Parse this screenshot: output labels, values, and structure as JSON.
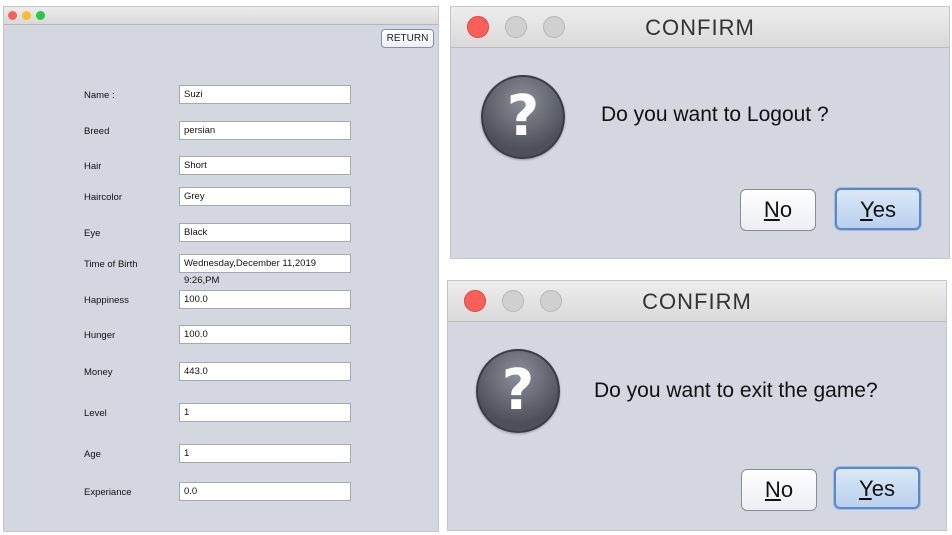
{
  "pet_window": {
    "return_label": "RETURN",
    "fields": [
      {
        "label": "Name :",
        "value": "Suzi"
      },
      {
        "label": "Breed",
        "value": "persian"
      },
      {
        "label": "Hair",
        "value": "Short"
      },
      {
        "label": "Haircolor",
        "value": "Grey"
      },
      {
        "label": "Eye",
        "value": "Black"
      },
      {
        "label": "Time of Birth",
        "value": "Wednesday,December 11,2019 9:26,PM"
      },
      {
        "label": "Happiness",
        "value": "100.0"
      },
      {
        "label": "Hunger",
        "value": "100.0"
      },
      {
        "label": "Money",
        "value": "443.0"
      },
      {
        "label": "Level",
        "value": "1"
      },
      {
        "label": "Age",
        "value": "1"
      },
      {
        "label": "Experiance",
        "value": "0.0"
      }
    ]
  },
  "logout_dialog": {
    "title": "CONFIRM",
    "icon": "question-icon",
    "icon_glyph": "?",
    "message": "Do you want to Logout ?",
    "no_mnemonic": "N",
    "no_rest": "o",
    "yes_mnemonic": "Y",
    "yes_rest": "es"
  },
  "exit_dialog": {
    "title": "CONFIRM",
    "icon": "question-icon",
    "icon_glyph": "?",
    "message": "Do you want to exit the game?",
    "no_mnemonic": "N",
    "no_rest": "o",
    "yes_mnemonic": "Y",
    "yes_rest": "es"
  },
  "colors": {
    "window_bg": "#d5d7e0",
    "close_red": "#fc5f57",
    "minimize_yellow": "#fdbc2e",
    "zoom_green": "#28c840",
    "default_button_blue": "#5a88c8"
  }
}
